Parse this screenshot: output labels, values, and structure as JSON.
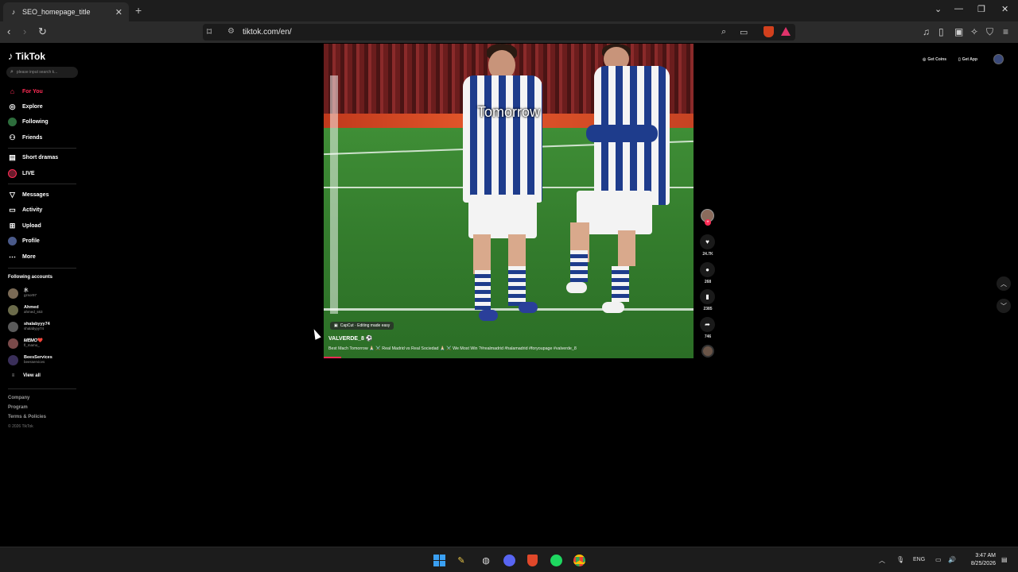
{
  "browser": {
    "tab_title": "SEO_homepage_title",
    "new_tab": "+",
    "url": "tiktok.com/en/"
  },
  "sidebar": {
    "logo": "TikTok",
    "search_placeholder": "please input search k...",
    "menu": [
      {
        "label": "For You",
        "icon": "home-icon"
      },
      {
        "label": "Explore",
        "icon": "compass-icon"
      },
      {
        "label": "Following",
        "icon": "following-icon"
      },
      {
        "label": "Friends",
        "icon": "friends-icon"
      },
      {
        "label": "Short dramas",
        "icon": "drama-icon"
      },
      {
        "label": "LIVE",
        "icon": "live-icon"
      },
      {
        "label": "Messages",
        "icon": "messages-icon"
      },
      {
        "label": "Activity",
        "icon": "activity-icon"
      },
      {
        "label": "Upload",
        "icon": "upload-icon"
      },
      {
        "label": "Profile",
        "icon": "profile-icon"
      },
      {
        "label": "More",
        "icon": "more-icon"
      }
    ],
    "following_title": "Following accounts",
    "accounts": [
      {
        "name": "水",
        "handle": "gzsor97"
      },
      {
        "name": "Ahmed",
        "handle": "ahmed_s63"
      },
      {
        "name": "shalabyyy74",
        "handle": "shalabyyy74"
      },
      {
        "name": "𝑀𝐸𝑀𝑂❤️",
        "handle": "fl_mamo_"
      },
      {
        "name": "BeesServices",
        "handle": "beesservices"
      }
    ],
    "view_all": "View all",
    "footer": [
      "Company",
      "Program",
      "Terms & Policies"
    ],
    "copyright": "© 2026 TikTok"
  },
  "topright": {
    "get_coins": "Get Coins",
    "get_app": "Get App"
  },
  "video": {
    "overlay_caption": "Tomorrow",
    "capcut_label": "CapCut · Editing made easy",
    "author": "VALVERDE_8 ⚽",
    "description": "Best Mach Tomorrow 🙏🏻 ⚔️ Real Madrid vs Real Sociedad 🙏🏻 ⚔️ We Most Win ?#realmadrid #halamadrid #foryoupage #valverde_8",
    "likes": "24.7K",
    "comments": "268",
    "saves": "2385",
    "shares": "746"
  },
  "taskbar": {
    "lang": "ENG",
    "time": "3:47 AM",
    "date": "8/25/2026"
  },
  "colors": {
    "accent": "#fe2c55",
    "background": "#000000",
    "chrome": "#2b2b2b"
  }
}
